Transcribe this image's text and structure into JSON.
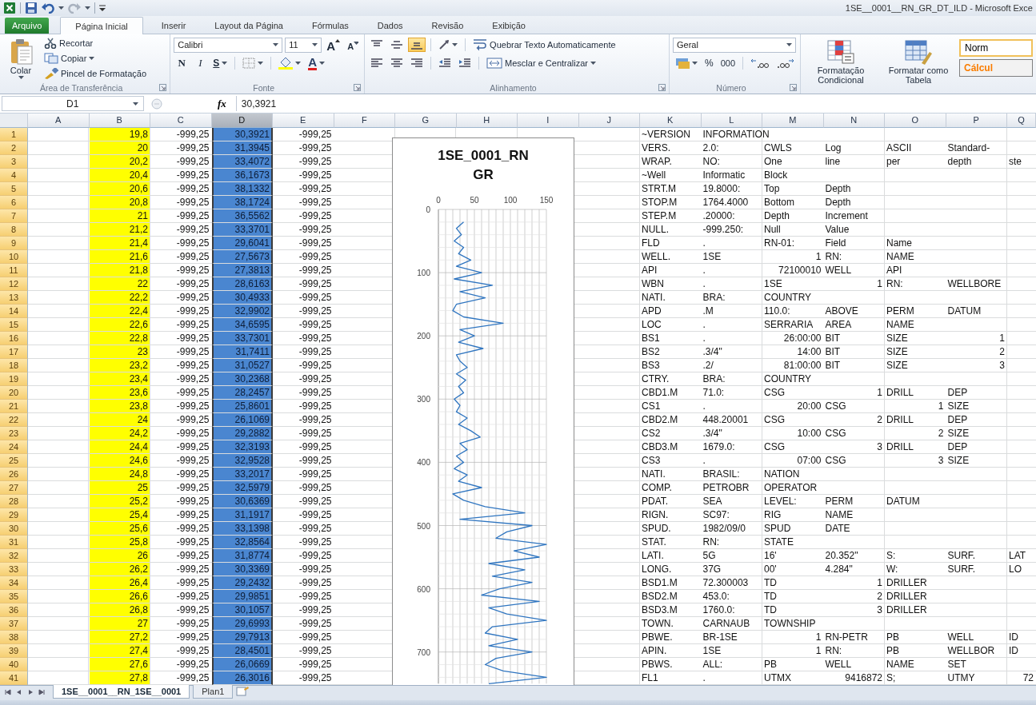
{
  "window": {
    "title": "1SE__0001__RN_GR_DT_ILD - Microsoft Exce"
  },
  "ribbon": {
    "file_tab": "Arquivo",
    "tabs": [
      {
        "label": "Página Inicial",
        "selected": true
      },
      {
        "label": "Inserir",
        "selected": false
      },
      {
        "label": "Layout da Página",
        "selected": false
      },
      {
        "label": "Fórmulas",
        "selected": false
      },
      {
        "label": "Dados",
        "selected": false
      },
      {
        "label": "Revisão",
        "selected": false
      },
      {
        "label": "Exibição",
        "selected": false
      }
    ],
    "clipboard": {
      "paste": "Colar",
      "cut": "Recortar",
      "copy": "Copiar",
      "format_painter": "Pincel de Formatação",
      "label": "Área de Transferência"
    },
    "font": {
      "name": "Calibri",
      "size": "11",
      "grow": "A",
      "shrink": "A",
      "bold": "N",
      "italic": "I",
      "underline": "S",
      "color_letter": "A",
      "label": "Fonte"
    },
    "alignment": {
      "vertical_align": [
        {
          "selected": false
        },
        {
          "selected": false
        },
        {
          "selected": true
        }
      ],
      "wrap_text": "Quebrar Texto Automaticamente",
      "merge": "Mesclar e Centralizar",
      "label": "Alinhamento"
    },
    "number": {
      "format": "Geral",
      "percent": "%",
      "thousands": "000",
      "label": "Número"
    },
    "styles": {
      "conditional": "Formatação Condicional",
      "as_table": "Formatar como Tabela",
      "cell_styles": [
        {
          "label": "Norm",
          "kind": "normal",
          "selected": true
        },
        {
          "label": "Cálcul",
          "kind": "calculation",
          "selected": false
        }
      ]
    }
  },
  "formula_bar": {
    "name_box": "D1",
    "function_label": "fx",
    "value": "30,3921"
  },
  "sheet": {
    "columns": [
      {
        "label": "A",
        "selected": false
      },
      {
        "label": "B",
        "selected": false,
        "color": "#ffff00"
      },
      {
        "label": "C",
        "selected": false
      },
      {
        "label": "D",
        "selected": true
      },
      {
        "label": "E",
        "selected": false
      },
      {
        "label": "F",
        "selected": false
      },
      {
        "label": "G",
        "selected": false
      },
      {
        "label": "H",
        "selected": false
      },
      {
        "label": "I",
        "selected": false
      },
      {
        "label": "J",
        "selected": false
      },
      {
        "label": "K",
        "selected": false
      },
      {
        "label": "L",
        "selected": false
      },
      {
        "label": "M",
        "selected": false
      },
      {
        "label": "N",
        "selected": false
      },
      {
        "label": "O",
        "selected": false
      },
      {
        "label": "P",
        "selected": false
      },
      {
        "label": "Q",
        "selected": false
      }
    ],
    "rows": [
      {
        "n": "1",
        "cells": {
          "B": "19,8",
          "C": "-999,25",
          "D": "30,3921",
          "E": "-999,25",
          "K": "~VERSION",
          "L": "INFORMATION"
        }
      },
      {
        "n": "2",
        "cells": {
          "B": "20",
          "C": "-999,25",
          "D": "31,3945",
          "E": "-999,25",
          "K": "VERS.",
          "L": "2.0:",
          "M": "CWLS",
          "N": "Log",
          "O": "ASCII",
          "P": "Standard-"
        }
      },
      {
        "n": "3",
        "cells": {
          "B": "20,2",
          "C": "-999,25",
          "D": "33,4072",
          "E": "-999,25",
          "K": "WRAP.",
          "L": "NO:",
          "M": "One",
          "N": "line",
          "O": "per",
          "P": "depth",
          "Q": "ste"
        }
      },
      {
        "n": "4",
        "cells": {
          "B": "20,4",
          "C": "-999,25",
          "D": "36,1673",
          "E": "-999,25",
          "K": "~Well",
          "L": "Informatic",
          "M": "Block"
        }
      },
      {
        "n": "5",
        "cells": {
          "B": "20,6",
          "C": "-999,25",
          "D": "38,1332",
          "E": "-999,25",
          "K": "STRT.M",
          "L": "19.8000:",
          "M": "Top",
          "N": "Depth"
        }
      },
      {
        "n": "6",
        "cells": {
          "B": "20,8",
          "C": "-999,25",
          "D": "38,1724",
          "E": "-999,25",
          "K": "STOP.M",
          "L": "1764.4000",
          "M": "Bottom",
          "N": "Depth"
        }
      },
      {
        "n": "7",
        "cells": {
          "B": "21",
          "C": "-999,25",
          "D": "36,5562",
          "E": "-999,25",
          "K": "STEP.M",
          "L": ".20000:",
          "M": "Depth",
          "N": "Increment"
        }
      },
      {
        "n": "8",
        "cells": {
          "B": "21,2",
          "C": "-999,25",
          "D": "33,3701",
          "E": "-999,25",
          "K": "NULL.",
          "L": "-999.250:",
          "M": "Null",
          "N": "Value"
        }
      },
      {
        "n": "9",
        "cells": {
          "B": "21,4",
          "C": "-999,25",
          "D": "29,6041",
          "E": "-999,25",
          "K": "FLD",
          "L": ".",
          "M": "RN-01:",
          "N": "Field",
          "O": "Name"
        }
      },
      {
        "n": "10",
        "cells": {
          "B": "21,6",
          "C": "-999,25",
          "D": "27,5673",
          "E": "-999,25",
          "K": "WELL.",
          "L": "1SE",
          "M": "1",
          "N": "RN:",
          "O": "NAME"
        }
      },
      {
        "n": "11",
        "cells": {
          "B": "21,8",
          "C": "-999,25",
          "D": "27,3813",
          "E": "-999,25",
          "K": "API",
          "L": ".",
          "M": "72100010",
          "N": "WELL",
          "O": "API"
        }
      },
      {
        "n": "12",
        "cells": {
          "B": "22",
          "C": "-999,25",
          "D": "28,6163",
          "E": "-999,25",
          "K": "WBN",
          "L": ".",
          "M": "1SE",
          "N": "1",
          "O": "RN:",
          "P": "WELLBORE"
        }
      },
      {
        "n": "13",
        "cells": {
          "B": "22,2",
          "C": "-999,25",
          "D": "30,4933",
          "E": "-999,25",
          "K": "NATI.",
          "L": "BRA:",
          "M": "COUNTRY"
        }
      },
      {
        "n": "14",
        "cells": {
          "B": "22,4",
          "C": "-999,25",
          "D": "32,9902",
          "E": "-999,25",
          "K": "APD",
          "L": ".M",
          "M": "110.0:",
          "N": "ABOVE",
          "O": "PERM",
          "P": "DATUM"
        }
      },
      {
        "n": "15",
        "cells": {
          "B": "22,6",
          "C": "-999,25",
          "D": "34,6595",
          "E": "-999,25",
          "K": "LOC",
          "L": ".",
          "M": "SERRARIA",
          "N": "AREA",
          "O": "NAME"
        }
      },
      {
        "n": "16",
        "cells": {
          "B": "22,8",
          "C": "-999,25",
          "D": "33,7301",
          "E": "-999,25",
          "K": "BS1",
          "L": ".",
          "M": "26:00:00",
          "N": "BIT",
          "O": "SIZE",
          "P": "1"
        }
      },
      {
        "n": "17",
        "cells": {
          "B": "23",
          "C": "-999,25",
          "D": "31,7411",
          "E": "-999,25",
          "K": "BS2",
          "L": ".3/4\"",
          "M": "14:00",
          "N": "BIT",
          "O": "SIZE",
          "P": "2"
        }
      },
      {
        "n": "18",
        "cells": {
          "B": "23,2",
          "C": "-999,25",
          "D": "31,0527",
          "E": "-999,25",
          "K": "BS3",
          "L": ".2/",
          "M": "81:00:00",
          "N": "BIT",
          "O": "SIZE",
          "P": "3"
        }
      },
      {
        "n": "19",
        "cells": {
          "B": "23,4",
          "C": "-999,25",
          "D": "30,2368",
          "E": "-999,25",
          "K": "CTRY.",
          "L": "BRA:",
          "M": "COUNTRY"
        }
      },
      {
        "n": "20",
        "cells": {
          "B": "23,6",
          "C": "-999,25",
          "D": "28,2457",
          "E": "-999,25",
          "K": "CBD1.M",
          "L": "71.0:",
          "M": "CSG",
          "N": "1",
          "O": "DRILL",
          "P": "DEP"
        }
      },
      {
        "n": "21",
        "cells": {
          "B": "23,8",
          "C": "-999,25",
          "D": "25,8601",
          "E": "-999,25",
          "K": "CS1",
          "L": ".",
          "M": "20:00",
          "N": "CSG",
          "O": "1",
          "P": "SIZE"
        }
      },
      {
        "n": "22",
        "cells": {
          "B": "24",
          "C": "-999,25",
          "D": "26,1069",
          "E": "-999,25",
          "K": "CBD2.M",
          "L": "448.20001",
          "M": "CSG",
          "N": "2",
          "O": "DRILL",
          "P": "DEP"
        }
      },
      {
        "n": "23",
        "cells": {
          "B": "24,2",
          "C": "-999,25",
          "D": "29,2882",
          "E": "-999,25",
          "K": "CS2",
          "L": ".3/4\"",
          "M": "10:00",
          "N": "CSG",
          "O": "2",
          "P": "SIZE"
        }
      },
      {
        "n": "24",
        "cells": {
          "B": "24,4",
          "C": "-999,25",
          "D": "32,3193",
          "E": "-999,25",
          "K": "CBD3.M",
          "L": "1679.0:",
          "M": "CSG",
          "N": "3",
          "O": "DRILL",
          "P": "DEP"
        }
      },
      {
        "n": "25",
        "cells": {
          "B": "24,6",
          "C": "-999,25",
          "D": "32,9528",
          "E": "-999,25",
          "K": "CS3",
          "L": ".",
          "M": "07:00",
          "N": "CSG",
          "O": "3",
          "P": "SIZE"
        }
      },
      {
        "n": "26",
        "cells": {
          "B": "24,8",
          "C": "-999,25",
          "D": "33,2017",
          "E": "-999,25",
          "K": "NATI.",
          "L": "BRASIL:",
          "M": "NATION"
        }
      },
      {
        "n": "27",
        "cells": {
          "B": "25",
          "C": "-999,25",
          "D": "32,5979",
          "E": "-999,25",
          "K": "COMP.",
          "L": "PETROBR",
          "M": "OPERATOR"
        }
      },
      {
        "n": "28",
        "cells": {
          "B": "25,2",
          "C": "-999,25",
          "D": "30,6369",
          "E": "-999,25",
          "K": "PDAT.",
          "L": "SEA",
          "M": "LEVEL:",
          "N": "PERM",
          "O": "DATUM"
        }
      },
      {
        "n": "29",
        "cells": {
          "B": "25,4",
          "C": "-999,25",
          "D": "31,1917",
          "E": "-999,25",
          "K": "RIGN.",
          "L": "SC97:",
          "M": "RIG",
          "N": "NAME"
        }
      },
      {
        "n": "30",
        "cells": {
          "B": "25,6",
          "C": "-999,25",
          "D": "33,1398",
          "E": "-999,25",
          "K": "SPUD.",
          "L": "1982/09/0",
          "M": "SPUD",
          "N": "DATE"
        }
      },
      {
        "n": "31",
        "cells": {
          "B": "25,8",
          "C": "-999,25",
          "D": "32,8564",
          "E": "-999,25",
          "K": "STAT.",
          "L": "RN:",
          "M": "STATE"
        }
      },
      {
        "n": "32",
        "cells": {
          "B": "26",
          "C": "-999,25",
          "D": "31,8774",
          "E": "-999,25",
          "K": "LATI.",
          "L": "5G",
          "M": "16'",
          "N": "20.352\"",
          "O": "S:",
          "P": "SURF.",
          "Q": "LAT"
        }
      },
      {
        "n": "33",
        "cells": {
          "B": "26,2",
          "C": "-999,25",
          "D": "30,3369",
          "E": "-999,25",
          "K": "LONG.",
          "L": "37G",
          "M": "00'",
          "N": "4.284\"",
          "O": "W:",
          "P": "SURF.",
          "Q": "LO"
        }
      },
      {
        "n": "34",
        "cells": {
          "B": "26,4",
          "C": "-999,25",
          "D": "29,2432",
          "E": "-999,25",
          "K": "BSD1.M",
          "L": "72.300003",
          "M": "TD",
          "N": "1",
          "O": "DRILLER"
        }
      },
      {
        "n": "35",
        "cells": {
          "B": "26,6",
          "C": "-999,25",
          "D": "29,9851",
          "E": "-999,25",
          "K": "BSD2.M",
          "L": "453.0:",
          "M": "TD",
          "N": "2",
          "O": "DRILLER"
        }
      },
      {
        "n": "36",
        "cells": {
          "B": "26,8",
          "C": "-999,25",
          "D": "30,1057",
          "E": "-999,25",
          "K": "BSD3.M",
          "L": "1760.0:",
          "M": "TD",
          "N": "3",
          "O": "DRILLER"
        }
      },
      {
        "n": "37",
        "cells": {
          "B": "27",
          "C": "-999,25",
          "D": "29,6993",
          "E": "-999,25",
          "K": "TOWN.",
          "L": "CARNAUB",
          "M": "TOWNSHIP"
        }
      },
      {
        "n": "38",
        "cells": {
          "B": "27,2",
          "C": "-999,25",
          "D": "29,7913",
          "E": "-999,25",
          "K": "PBWE.",
          "L": "BR-1SE",
          "M": "1",
          "N": "RN-PETR",
          "O": "PB",
          "P": "WELL",
          "Q": "ID"
        }
      },
      {
        "n": "39",
        "cells": {
          "B": "27,4",
          "C": "-999,25",
          "D": "28,4501",
          "E": "-999,25",
          "K": "APIN.",
          "L": "1SE",
          "M": "1",
          "N": "RN:",
          "O": "PB",
          "P": "WELLBOR",
          "Q": "ID"
        }
      },
      {
        "n": "40",
        "cells": {
          "B": "27,6",
          "C": "-999,25",
          "D": "26,0669",
          "E": "-999,25",
          "K": "PBWS.",
          "L": "ALL:",
          "M": "PB",
          "N": "WELL",
          "O": "NAME",
          "P": "SET"
        }
      },
      {
        "n": "41",
        "cells": {
          "B": "27,8",
          "C": "-999,25",
          "D": "26,3016",
          "E": "-999,25",
          "K": "FL1",
          "L": ".",
          "M": "UTMX",
          "N": "9416872",
          "O": "S;",
          "P": "UTMY",
          "Q": "72"
        }
      }
    ],
    "chart": {
      "chart_data": {
        "type": "line",
        "title": "1SE_0001_RN GR",
        "x": [
          35,
          25,
          32,
          22,
          35,
          28,
          45,
          25,
          60,
          22,
          75,
          30,
          65,
          25,
          20,
          35,
          90,
          30,
          50,
          28,
          62,
          25,
          30,
          40,
          25,
          38,
          28,
          35,
          22,
          30,
          25,
          40,
          28,
          45,
          58,
          30,
          40,
          25,
          35,
          22,
          40,
          28,
          60,
          20,
          35,
          65,
          120,
          30,
          130,
          95,
          80,
          150,
          105,
          140,
          70,
          120,
          75,
          130,
          85,
          60,
          140,
          70,
          95,
          150,
          75,
          65,
          110,
          70,
          130,
          80,
          65,
          90,
          150,
          70
        ],
        "series": [
          {
            "color": "#2f75c0",
            "values": [
              20,
              30,
              40,
              50,
              60,
              70,
              80,
              90,
              100,
              110,
              120,
              130,
              140,
              150,
              160,
              170,
              180,
              190,
              200,
              210,
              220,
              230,
              240,
              250,
              260,
              270,
              280,
              290,
              300,
              310,
              320,
              330,
              340,
              350,
              360,
              370,
              380,
              390,
              400,
              410,
              420,
              430,
              440,
              450,
              460,
              470,
              480,
              490,
              500,
              510,
              520,
              530,
              540,
              550,
              560,
              570,
              580,
              590,
              600,
              610,
              620,
              630,
              640,
              650,
              660,
              670,
              680,
              690,
              700,
              710,
              720,
              730,
              740,
              750
            ]
          }
        ],
        "xlim": [
          0,
          150
        ],
        "ylim": [
          750,
          0
        ],
        "grid": true,
        "xticks": [
          0,
          50,
          100,
          150
        ],
        "yticks": [
          0,
          100,
          200,
          300,
          400,
          500,
          600,
          700
        ]
      }
    }
  },
  "sheet_tabs": [
    {
      "label": "1SE__0001__RN_1SE__0001",
      "selected": true
    },
    {
      "label": "Plan1",
      "selected": false
    }
  ]
}
